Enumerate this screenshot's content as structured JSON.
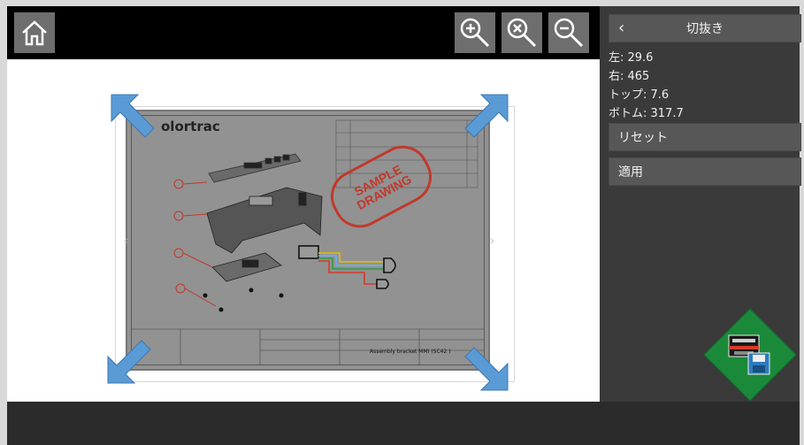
{
  "toolbar": {
    "home_icon": "home-icon",
    "zoom_in_icon": "zoom-in-icon",
    "zoom_fit_icon": "zoom-reset-icon",
    "zoom_out_icon": "zoom-out-icon"
  },
  "panel": {
    "title": "切抜き",
    "back_icon": "chevron-left-icon",
    "crop": {
      "left": "左: 29.6",
      "right": "右: 465",
      "top": "トップ: 7.6",
      "bottom": "ボトム: 317.7"
    },
    "reset_label": "リセット",
    "apply_label": "適用",
    "save_icon": "save-to-printer-icon"
  },
  "document": {
    "brand": "olortrac",
    "stamp_line1": "SAMPLE",
    "stamp_line2": "DRAWING",
    "drawing_title": "Assembly bracket MMI (SC42 )"
  },
  "colors": {
    "toolbar_bg": "#000000",
    "button_bg": "#6e6e6e",
    "panel_bg": "#3a3a3a",
    "arrow_blue": "#5b9bd5",
    "stamp_red": "#c0392b",
    "diamond_green": "#1a8a3a"
  }
}
